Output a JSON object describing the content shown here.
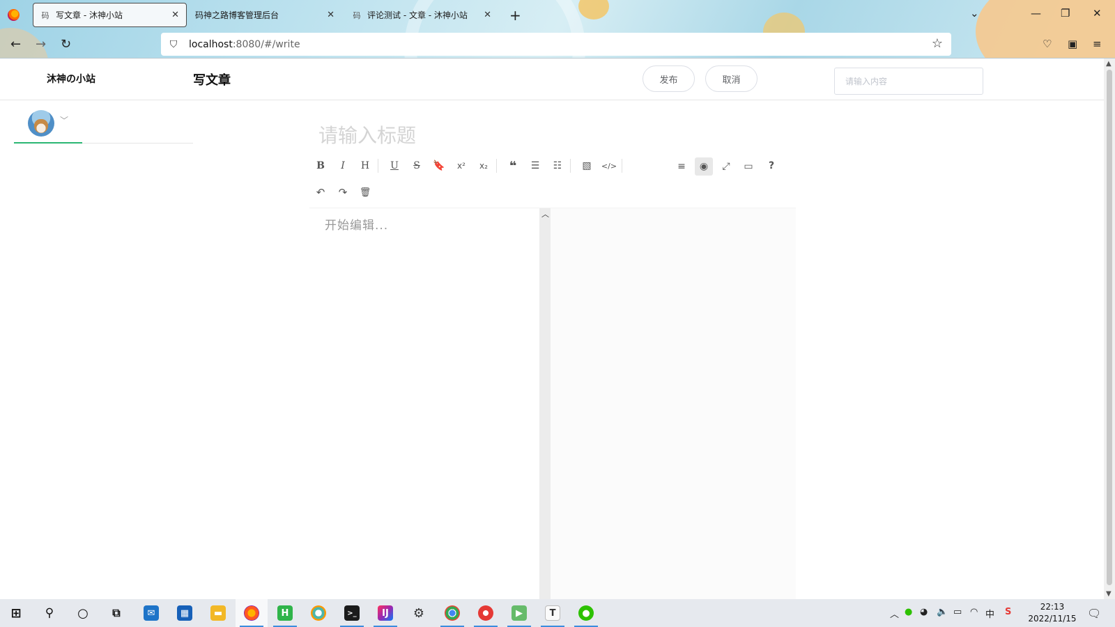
{
  "browser": {
    "tabs": [
      {
        "favicon": "码",
        "label": "写文章 - 沐神小站",
        "active": true
      },
      {
        "favicon": "",
        "label": "码神之路博客管理后台",
        "active": false
      },
      {
        "favicon": "码",
        "label": "评论测试 - 文章 - 沐神小站",
        "active": false
      }
    ],
    "close_glyph": "✕",
    "new_tab_glyph": "+",
    "url_host": "localhost",
    "url_path": ":8080/#/write",
    "icons": [
      "firefox-logo-icon",
      "back-arrow-icon",
      "forward-arrow-icon",
      "reload-icon",
      "shield-icon",
      "page-icon",
      "bookmark-star-icon",
      "pocket-icon",
      "extension-icon",
      "menu-icon",
      "tab-list-icon",
      "minimize-icon",
      "restore-icon",
      "close-window-icon"
    ]
  },
  "header": {
    "brand": "沐神の小站",
    "page_title": "写文章",
    "publish_label": "发布",
    "cancel_label": "取消",
    "search_placeholder": "请输入内容"
  },
  "sidebar": {
    "icons": [
      "avatar",
      "chevron-down-icon"
    ]
  },
  "editor": {
    "title_placeholder": "请输入标题",
    "content_placeholder": "开始编辑...",
    "toolbar_row1": [
      "bold",
      "italic",
      "heading",
      "underline",
      "strikethrough",
      "mark",
      "superscript",
      "subscript",
      "quote",
      "ordered-list",
      "unordered-list",
      "image",
      "code"
    ],
    "toolbar_row1_right": [
      "navigation",
      "preview-toggle",
      "fullscreen",
      "read-mode",
      "help"
    ],
    "toolbar_row2": [
      "undo",
      "redo",
      "trash"
    ]
  },
  "taskbar": {
    "apps": [
      "windows-start-icon",
      "search-icon",
      "cortana-icon",
      "task-view-icon",
      "mail-icon",
      "store-icon",
      "file-explorer-icon",
      "firefox-icon",
      "hbuilder-icon",
      "browser-icon",
      "terminal-icon",
      "intellij-icon",
      "settings-icon",
      "chrome-icon",
      "app-icon",
      "video-icon",
      "typora-icon",
      "wechat-icon"
    ],
    "time": "22:13",
    "date": "2022/11/15"
  },
  "colors": {
    "accent": "#2bb673",
    "border": "#dcdfe6",
    "placeholder": "#c0c4cc"
  }
}
